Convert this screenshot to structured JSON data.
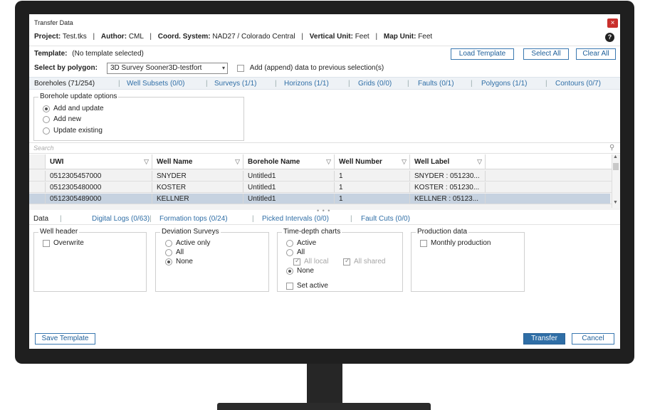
{
  "window": {
    "title": "Transfer Data",
    "close_symbol": "×"
  },
  "project_info": {
    "project_label": "Project:",
    "project_value": "Test.tks",
    "author_label": "Author:",
    "author_value": "CML",
    "coord_label": "Coord. System:",
    "coord_value": "NAD27 / Colorado Central",
    "vertical_label": "Vertical Unit:",
    "vertical_value": "Feet",
    "map_label": "Map Unit:",
    "map_value": "Feet",
    "separator": "|",
    "help_symbol": "?"
  },
  "template": {
    "label": "Template:",
    "value": "(No template selected)"
  },
  "toolbar": {
    "load_template": "Load Template",
    "select_all": "Select All",
    "clear_all": "Clear All"
  },
  "polygon": {
    "label": "Select by polygon:",
    "selected": "3D Survey Sooner3D-testfort",
    "append_label": "Add (append) data to previous selection(s)",
    "append_checked": false
  },
  "top_tabs": [
    {
      "label": "Boreholes (71/254)",
      "active": true
    },
    {
      "label": "Well Subsets (0/0)"
    },
    {
      "label": "Surveys (1/1)"
    },
    {
      "label": "Horizons (1/1)"
    },
    {
      "label": "Grids (0/0)"
    },
    {
      "label": "Faults (0/1)"
    },
    {
      "label": "Polygons (1/1)"
    },
    {
      "label": "Contours (0/7)"
    }
  ],
  "borehole_options": {
    "title": "Borehole update options",
    "options": [
      "Add and update",
      "Add new",
      "Update existing"
    ],
    "selected": "Add and update"
  },
  "search": {
    "placeholder": "Search"
  },
  "table": {
    "columns": [
      "UWI",
      "Well Name",
      "Borehole Name",
      "Well Number",
      "Well Label"
    ],
    "rows": [
      [
        "0512305457000",
        "SNYDER",
        "Untitled1",
        "1",
        "SNYDER : 051230..."
      ],
      [
        "0512305480000",
        "KOSTER",
        "Untitled1",
        "1",
        "KOSTER : 051230..."
      ],
      [
        "0512305489000",
        "KELLNER",
        "Untitled1",
        "1",
        "KELLNER : 05123..."
      ]
    ],
    "selected_row": 2,
    "selection_color": "#c6d2e0"
  },
  "bottom_tabs": [
    {
      "label": "Data",
      "active": true
    },
    {
      "label": "Digital Logs (0/63)"
    },
    {
      "label": "Formation tops (0/24)"
    },
    {
      "label": "Picked Intervals (0/0)"
    },
    {
      "label": "Fault Cuts (0/0)"
    }
  ],
  "well_header": {
    "title": "Well header",
    "overwrite": "Overwrite"
  },
  "deviation": {
    "title": "Deviation Surveys",
    "options": [
      "Active only",
      "All",
      "None"
    ],
    "selected": "None"
  },
  "time_depth": {
    "title": "Time-depth charts",
    "options": [
      "Active",
      "All",
      "None"
    ],
    "selected": "None",
    "all_local": "All local",
    "all_shared": "All shared",
    "set_active": "Set active"
  },
  "production": {
    "title": "Production data",
    "monthly": "Monthly production"
  },
  "footer": {
    "save_template": "Save Template",
    "transfer": "Transfer",
    "cancel": "Cancel"
  },
  "colors": {
    "accent": "#2f6ea6",
    "primary_button": "#2f6ea6",
    "close": "#c9302c"
  }
}
